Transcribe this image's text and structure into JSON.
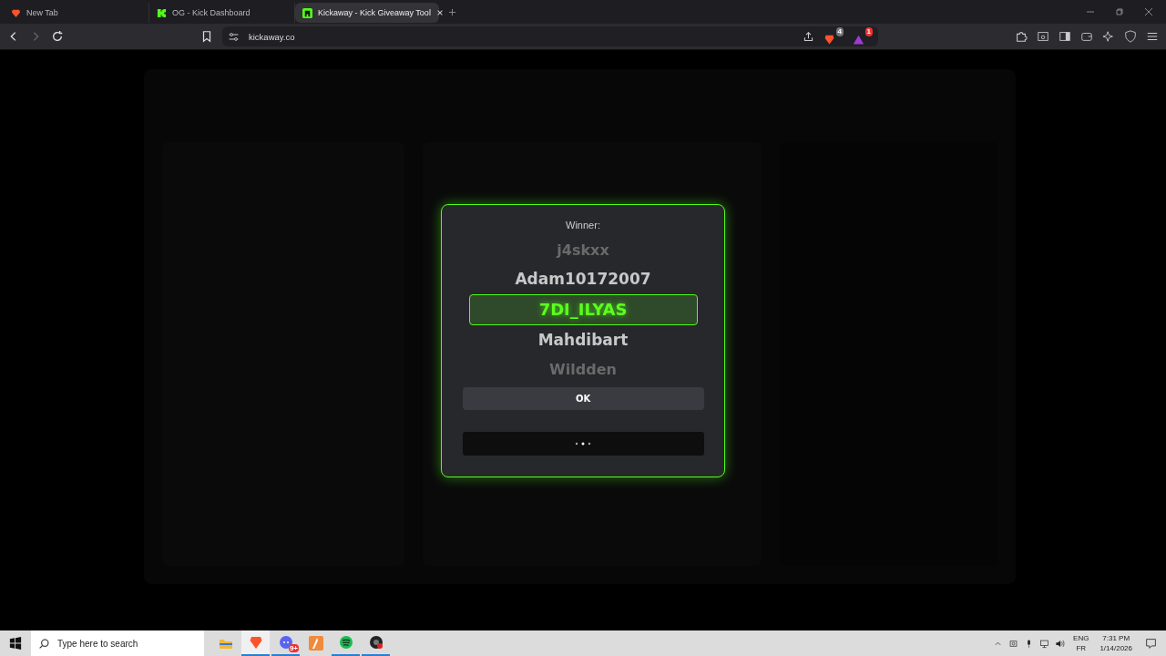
{
  "browser": {
    "tabs": [
      {
        "title": "New Tab",
        "selected": false
      },
      {
        "title": "OG - Kick Dashboard",
        "selected": false
      },
      {
        "title": "Kickaway - Kick Giveaway Tool",
        "selected": true
      }
    ],
    "address": "kickaway.co",
    "shields_badge": "4",
    "rewards_badge": "1"
  },
  "modal": {
    "label": "Winner:",
    "names": [
      {
        "name": "j4skxx",
        "selected": false
      },
      {
        "name": "Adam10172007",
        "selected": false
      },
      {
        "name": "7DI_ILYAS",
        "selected": true
      },
      {
        "name": "Mahdibart",
        "selected": false
      },
      {
        "name": "Wildden",
        "selected": false
      }
    ],
    "ok_button": "OK"
  },
  "taskbar": {
    "search_placeholder": "Type here to search",
    "apps": [
      {
        "kind": "files",
        "running": false,
        "selected": false
      },
      {
        "kind": "brave",
        "running": true,
        "selected": true
      },
      {
        "kind": "discord",
        "running": true,
        "selected": false,
        "badge": "9+"
      },
      {
        "kind": "app",
        "running": false,
        "selected": false
      },
      {
        "kind": "spotify",
        "running": true,
        "selected": false
      },
      {
        "kind": "obs",
        "running": true,
        "selected": false
      }
    ],
    "language": "ENG",
    "layout": "FR",
    "time": "7:31 PM",
    "date": "1/14/2026"
  }
}
